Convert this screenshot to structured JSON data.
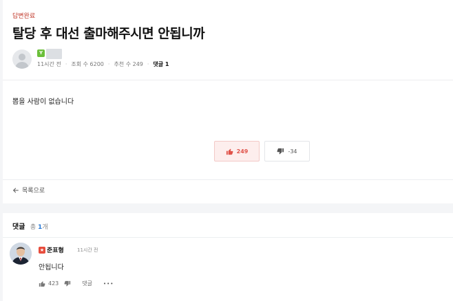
{
  "post": {
    "status": "답변완료",
    "title": "탈당 후 대선 출마해주시면 안됩니까",
    "author_badge": "Y",
    "meta": {
      "time": "11시간 전",
      "views": "조회 수 6200",
      "recommends": "추천 수 249",
      "comments": "댓글 1"
    },
    "body": "뽑을 사람이 없습니다",
    "vote_up_count": "249",
    "vote_down_count": "-34",
    "back_label": "목록으로"
  },
  "comments": {
    "header_label": "댓글",
    "total_label": "총",
    "total_count": "1",
    "total_suffix": "개",
    "items": [
      {
        "badge": "★",
        "name": "준표형",
        "time": "11시간 전",
        "text": "안됩니다",
        "likes": "423",
        "reply_label": "댓글",
        "more_label": "•••"
      }
    ]
  },
  "colors": {
    "accent_red": "#e0534a",
    "accent_blue": "#2a7ad5",
    "badge_green": "#6bbf3a"
  },
  "icons": [
    "user-avatar-icon",
    "thumbs-up-icon",
    "thumbs-down-icon",
    "arrow-left-icon",
    "more-icon"
  ]
}
